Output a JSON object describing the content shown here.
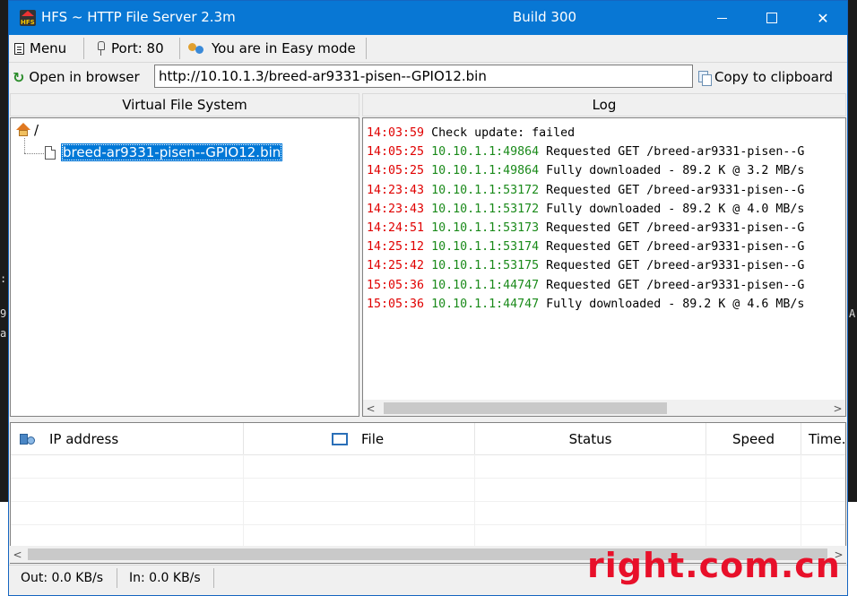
{
  "window": {
    "title": "HFS ~ HTTP File Server 2.3m",
    "build": "Build 300",
    "app_icon_text": "HFS"
  },
  "menubar": {
    "menu_label": "Menu",
    "port_label": "Port: 80",
    "mode_label": "You are in Easy mode"
  },
  "urlbar": {
    "open_label": "Open in browser",
    "url_value": "http://10.10.1.3/breed-ar9331-pisen--GPIO12.bin",
    "copy_label": "Copy to clipboard"
  },
  "vfs": {
    "header": "Virtual File System",
    "root_label": "/",
    "file_label": "breed-ar9331-pisen--GPIO12.bin"
  },
  "log": {
    "header": "Log",
    "entries": [
      {
        "time": "14:03:59",
        "addr": "",
        "msg": "Check update: failed"
      },
      {
        "time": "14:05:25",
        "addr": "10.10.1.1:49864",
        "msg": "Requested GET /breed-ar9331-pisen--G"
      },
      {
        "time": "14:05:25",
        "addr": "10.10.1.1:49864",
        "msg": "Fully downloaded - 89.2 K @ 3.2 MB/s"
      },
      {
        "time": "14:23:43",
        "addr": "10.10.1.1:53172",
        "msg": "Requested GET /breed-ar9331-pisen--G"
      },
      {
        "time": "14:23:43",
        "addr": "10.10.1.1:53172",
        "msg": "Fully downloaded - 89.2 K @ 4.0 MB/s"
      },
      {
        "time": "14:24:51",
        "addr": "10.10.1.1:53173",
        "msg": "Requested GET /breed-ar9331-pisen--G"
      },
      {
        "time": "14:25:12",
        "addr": "10.10.1.1:53174",
        "msg": "Requested GET /breed-ar9331-pisen--G"
      },
      {
        "time": "14:25:42",
        "addr": "10.10.1.1:53175",
        "msg": "Requested GET /breed-ar9331-pisen--G"
      },
      {
        "time": "15:05:36",
        "addr": "10.10.1.1:44747",
        "msg": "Requested GET /breed-ar9331-pisen--G"
      },
      {
        "time": "15:05:36",
        "addr": "10.10.1.1:44747",
        "msg": "Fully downloaded - 89.2 K @ 4.6 MB/s"
      }
    ]
  },
  "connections": {
    "columns": {
      "ip": "IP address",
      "file": "File",
      "status": "Status",
      "speed": "Speed",
      "time": "Time.."
    }
  },
  "statusbar": {
    "out": "Out: 0.0 KB/s",
    "in": "In: 0.0 KB/s"
  },
  "watermark": "right.com.cn",
  "colors": {
    "titlebar": "#0877d4",
    "selection": "#0078d7",
    "log_time": "#e00000",
    "log_addr": "#1a8a1a",
    "watermark": "#e8102a"
  },
  "icons": {
    "menu": "menu-icon",
    "port": "port-icon",
    "mode": "users-icon",
    "open": "open-browser-icon",
    "copy": "copy-icon",
    "root": "home-icon",
    "file": "file-icon",
    "ip": "network-icon",
    "file_col": "window-icon"
  }
}
